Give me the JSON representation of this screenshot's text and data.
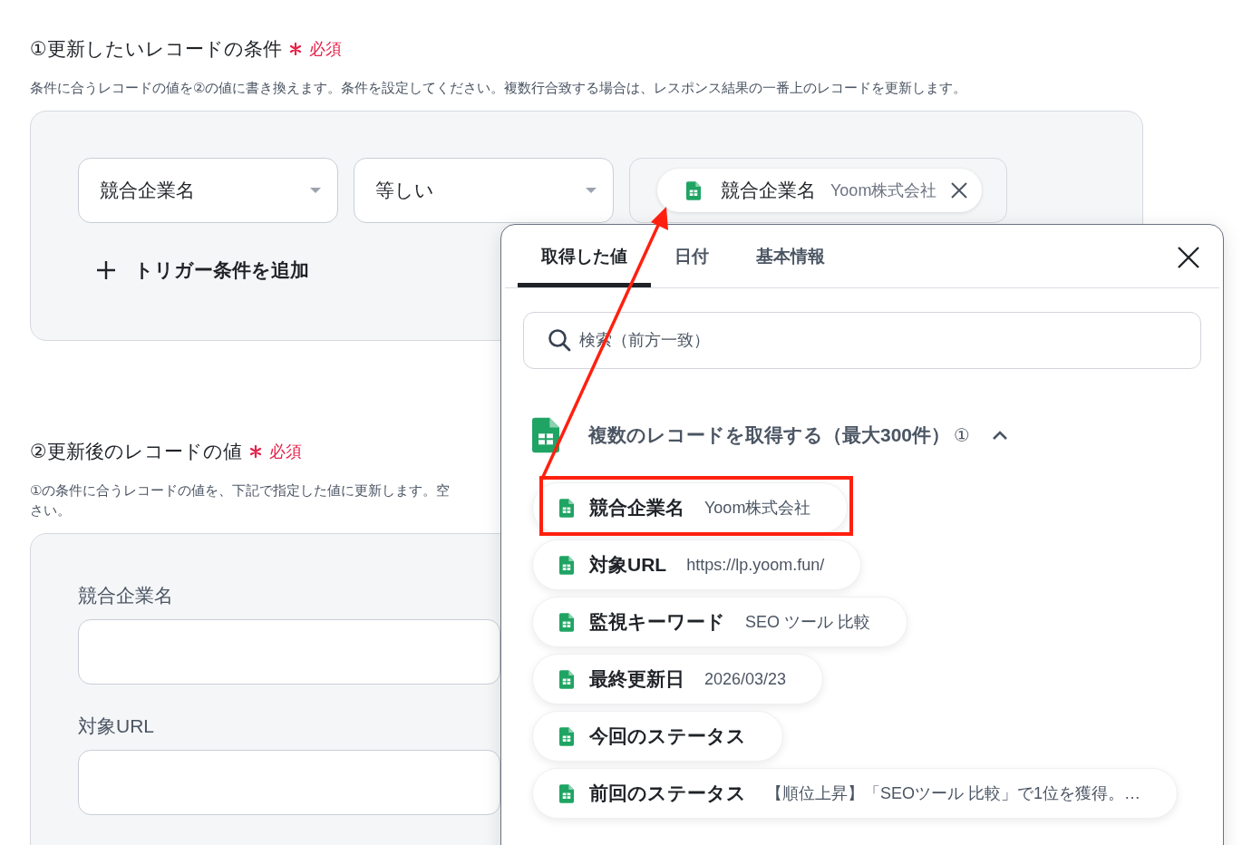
{
  "condition_section": {
    "title": "①更新したいレコードの条件",
    "required_label": "必須",
    "description": "条件に合うレコードの値を②の値に書き換えます。条件を設定してください。複数行合致する場合は、レスポンス結果の一番上のレコードを更新します。",
    "field_select": {
      "value": "競合企業名"
    },
    "operator_select": {
      "value": "等しい"
    },
    "value_chip": {
      "label": "競合企業名",
      "value": "Yoom株式会社"
    },
    "add_trigger": "トリガー条件を追加"
  },
  "update_section": {
    "title": "②更新後のレコードの値",
    "required_label": "必須",
    "description_lines": [
      "①の条件に合うレコードの値を、下記で指定した値に更新します。空",
      "さい。"
    ],
    "fields": [
      {
        "label": "競合企業名"
      },
      {
        "label": "対象URL"
      }
    ]
  },
  "picker": {
    "tabs": [
      {
        "label": "取得した値",
        "selected": true
      },
      {
        "label": "日付",
        "selected": false
      },
      {
        "label": "基本情報",
        "selected": false
      }
    ],
    "search": {
      "placeholder": "検索（前方一致）"
    },
    "group": {
      "title": "複数のレコードを取得する（最大300件）",
      "info_mark": "①",
      "expanded": true
    },
    "items": [
      {
        "label": "競合企業名",
        "value": "Yoom株式会社",
        "highlighted": true
      },
      {
        "label": "対象URL",
        "value": "https://lp.yoom.fun/",
        "highlighted": false
      },
      {
        "label": "監視キーワード",
        "value": "SEO ツール 比較",
        "highlighted": false
      },
      {
        "label": "最終更新日",
        "value": "2026/03/23",
        "highlighted": false
      },
      {
        "label": "今回のステータス",
        "highlighted": false
      },
      {
        "label": "前回のステータス",
        "value": "【順位上昇】「SEOツール 比較」で1位を獲得。…",
        "highlighted": false
      }
    ]
  }
}
